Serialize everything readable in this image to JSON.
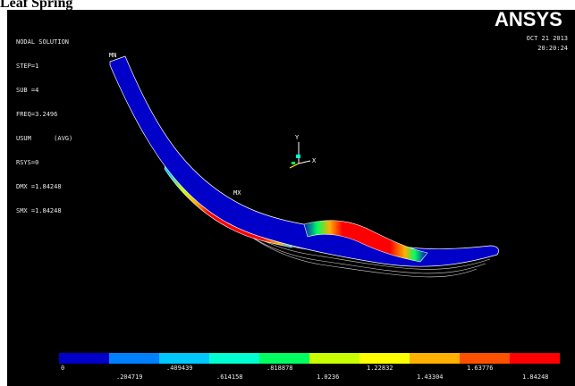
{
  "page_title": "Leaf Spring",
  "solution": {
    "header": "NODAL SOLUTION",
    "lines": [
      "STEP=1",
      "SUB =4",
      "FREQ=3.2496",
      "USUM      (AVG)",
      "RSYS=0",
      "DMX =1.84248",
      "SMX =1.84248"
    ]
  },
  "brand": {
    "logo_text": "ANSYS"
  },
  "datetime": {
    "date": "OCT 21 2013",
    "time": "20:20:24"
  },
  "markers": {
    "mx": "MX",
    "mn": "MN"
  },
  "triad": {
    "y": "Y",
    "x": "X"
  },
  "legend": {
    "colors": [
      "#0000c8",
      "#0080ff",
      "#00c8ff",
      "#00ffd0",
      "#00ff60",
      "#c8ff00",
      "#ffff00",
      "#ffb000",
      "#ff5000",
      "#ff0000"
    ],
    "top_labels": [
      "0",
      ".409439",
      ".818878",
      "1.22832",
      "1.63776"
    ],
    "bottom_labels": [
      ".204719",
      ".614158",
      "1.0236",
      "1.43304",
      "1.84248"
    ]
  }
}
